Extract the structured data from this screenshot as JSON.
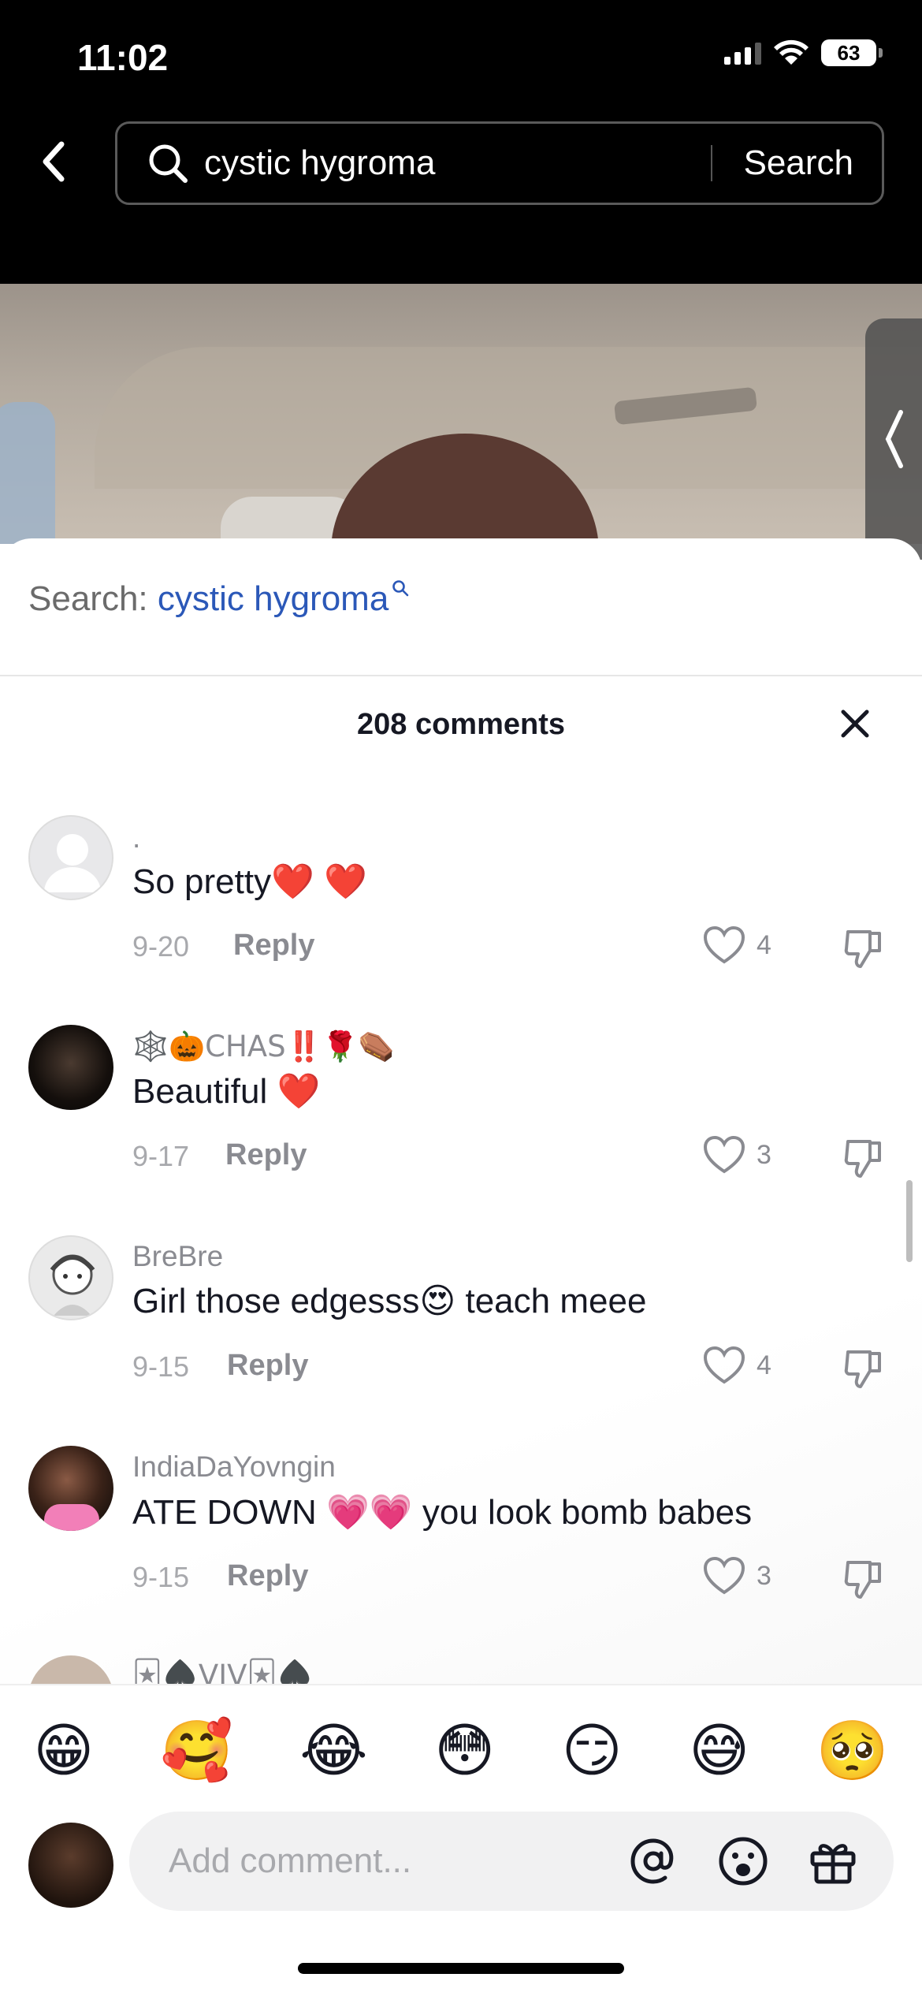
{
  "status_bar": {
    "time": "11:02",
    "battery": "63"
  },
  "header": {
    "query": "cystic hygroma",
    "search_button": "Search"
  },
  "sheet": {
    "search_label": "Search:",
    "search_term": "cystic hygroma",
    "comments_count": "208 comments"
  },
  "comments": [
    {
      "user": ".",
      "text": "So pretty❤️ ❤️",
      "date": "9-20",
      "reply": "Reply",
      "likes": "4"
    },
    {
      "user": "🕸️🎃CHAS‼️🌹⚰️",
      "text": "Beautiful ❤️",
      "date": "9-17",
      "reply": "Reply",
      "likes": "3"
    },
    {
      "user": "BreBre",
      "text": "Girl those edgesss😍 teach meee",
      "date": "9-15",
      "reply": "Reply",
      "likes": "4"
    },
    {
      "user": "IndiaDaYovngin",
      "text": "ATE DOWN 💗💗 you look bomb babes",
      "date": "9-15",
      "reply": "Reply",
      "likes": "3"
    },
    {
      "user": "🃏♠️VIV🃏♠️"
    }
  ],
  "emoji_bar": [
    "😁",
    "🥰",
    "😂",
    "😳",
    "😏",
    "😅",
    "🥺"
  ],
  "composer": {
    "placeholder": "Add comment..."
  }
}
